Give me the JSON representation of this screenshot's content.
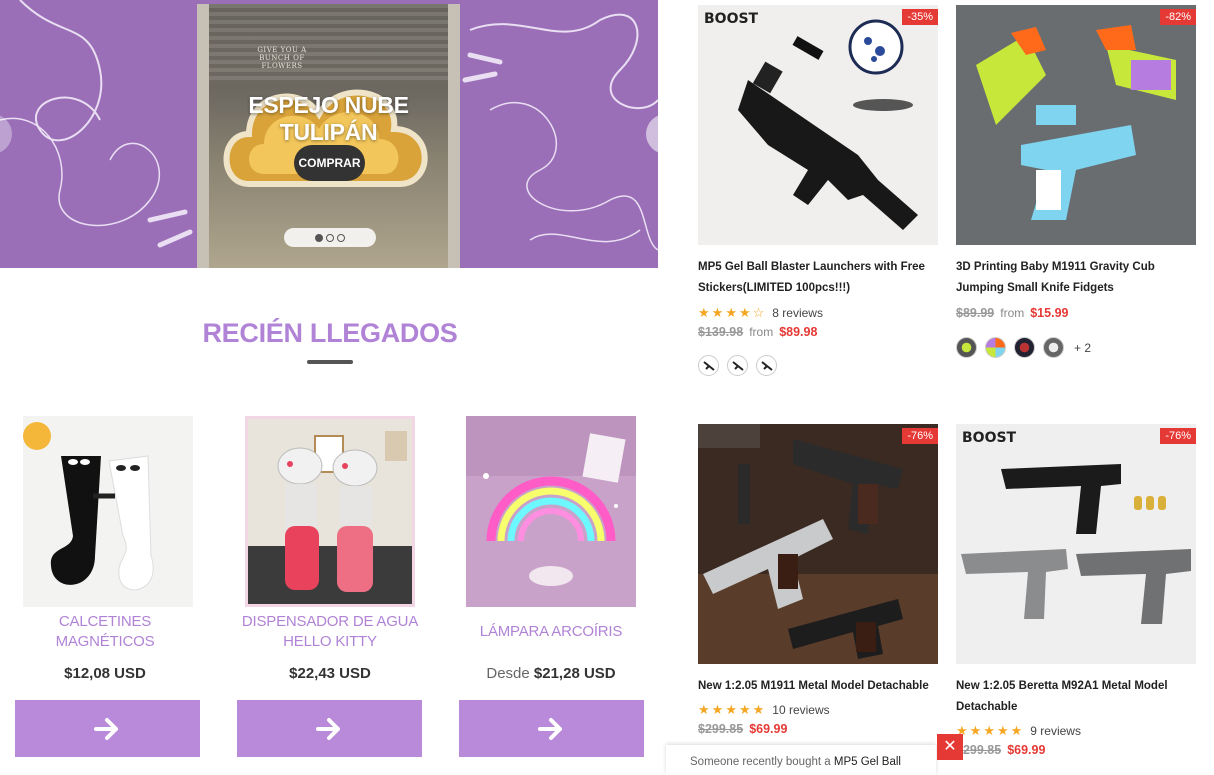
{
  "hero": {
    "small_text": "GIVE YOU A BUNCH OF FLOWERS",
    "title": "ESPEJO NUBE TULIPÁN",
    "button": "COMPRAR",
    "slides": 3,
    "active_slide": 1
  },
  "section": {
    "title": "RECIÉN LLEGADOS"
  },
  "arrivals": [
    {
      "name": "CALCETINES MAGNÉTICOS",
      "price": "$12,08 USD",
      "from": ""
    },
    {
      "name": "DISPENSADOR DE AGUA HELLO KITTY",
      "price": "$22,43 USD",
      "from": ""
    },
    {
      "name": "LÁMPARA ARCOÍRIS",
      "price": "$21,28 USD",
      "from": "Desde"
    }
  ],
  "products": [
    {
      "brand": "BOOST",
      "discount": "-35%",
      "title": "MP5 Gel Ball Blaster Launchers with Free Stickers(LIMITED 100pcs!!!)",
      "stars": 4,
      "reviews": "8 reviews",
      "old_price": "$139.98",
      "from": "from",
      "price": "$89.98",
      "swatch_more": ""
    },
    {
      "brand": "",
      "discount": "-82%",
      "title": "3D Printing Baby M1911 Gravity Cub Jumping Small Knife Fidgets",
      "stars": 0,
      "reviews": "",
      "old_price": "$89.99",
      "from": "from",
      "price": "$15.99",
      "swatch_more": "+ 2"
    },
    {
      "brand": "",
      "discount": "-76%",
      "title": "New 1:2.05 M1911 Metal Model Detachable",
      "stars": 5,
      "reviews": "10 reviews",
      "old_price": "$299.85",
      "from": "",
      "price": "$69.99",
      "swatch_more": ""
    },
    {
      "brand": "BOOST",
      "discount": "-76%",
      "title": "New 1:2.05 Beretta M92A1 Metal Model Detachable",
      "stars": 5,
      "reviews": "9 reviews",
      "old_price": "$299.85",
      "from": "",
      "price": "$69.99",
      "swatch_more": ""
    }
  ],
  "recent": {
    "prefix": "Someone recently bought a",
    "product": "MP5 Gel Ball"
  },
  "colors": {
    "lavender": "#9a6fb8",
    "accent": "#b083d6",
    "button": "#b98ad9",
    "sale": "#e53935",
    "star": "#f5a623"
  }
}
